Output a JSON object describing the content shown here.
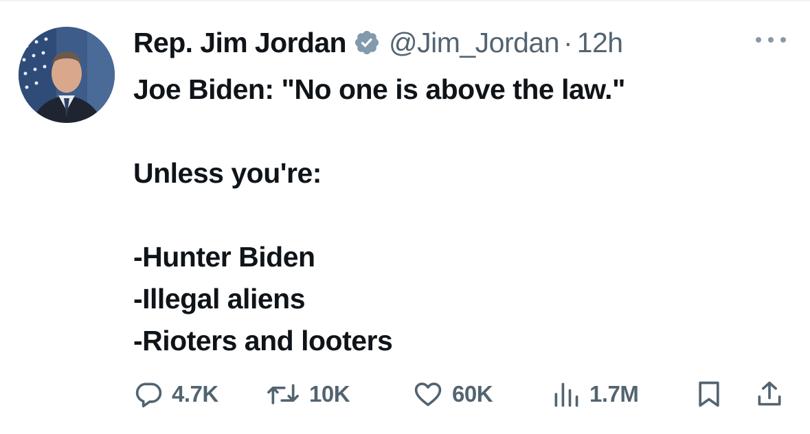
{
  "tweet": {
    "display_name": "Rep. Jim Jordan",
    "handle": "@Jim_Jordan",
    "separator": "·",
    "time": "12h",
    "verified": true,
    "lines": [
      "Joe Biden: \"No one is above the law.\"",
      "",
      "Unless you're:",
      "",
      "-Hunter Biden",
      "-Illegal aliens",
      "-Rioters and looters"
    ]
  },
  "actions": {
    "replies": "4.7K",
    "retweets": "10K",
    "likes": "60K",
    "views": "1.7M"
  },
  "icons": {
    "verified": "verified-badge-icon",
    "more": "more-options-icon",
    "reply": "reply-icon",
    "retweet": "retweet-icon",
    "like": "heart-icon",
    "views": "views-chart-icon",
    "bookmark": "bookmark-icon",
    "share": "share-icon"
  },
  "colors": {
    "text": "#0f1419",
    "secondary": "#536471",
    "verified_badge": "#829aab"
  }
}
